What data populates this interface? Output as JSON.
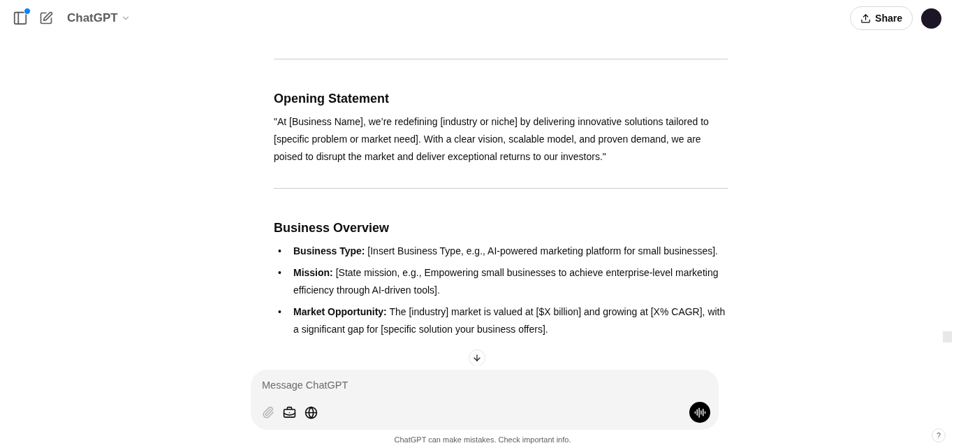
{
  "header": {
    "model": "ChatGPT",
    "share": "Share",
    "notification": true
  },
  "sections": [
    {
      "heading": "Opening Statement",
      "paragraph": "\"At [Business Name], we’re redefining [industry or niche] by delivering innovative solutions tailored to [specific problem or market need]. With a clear vision, scalable model, and proven demand, we are poised to disrupt the market and deliver exceptional returns to our investors.\""
    },
    {
      "heading": "Business Overview",
      "bullets": [
        {
          "marker": "•",
          "text": "**Business Type:** [Insert Business Type, e.g., AI-powered marketing platform for small businesses]."
        },
        {
          "marker": "•",
          "text": "**Mission:** [State mission, e.g., Empowering small businesses to achieve enterprise-level marketing efficiency through AI-driven tools]."
        },
        {
          "marker": "•",
          "text": "**Market Opportunity:** The [industry] market is valued at [$X billion] and growing at [X% CAGR], with a significant gap for [specific solution your business offers]."
        }
      ]
    }
  ],
  "composer": {
    "placeholder": "Message ChatGPT",
    "attach_disabled": true
  },
  "disclaimer": "ChatGPT can make mistakes. Check important info.",
  "help": "?"
}
